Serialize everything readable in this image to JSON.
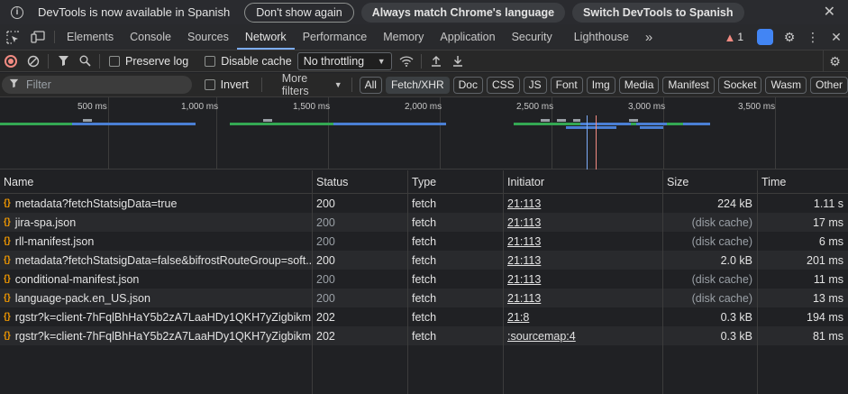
{
  "infobar": {
    "message": "DevTools is now available in Spanish",
    "dont_show": "Don't show again",
    "always_match": "Always match Chrome's language",
    "switch": "Switch DevTools to Spanish",
    "close": "✕"
  },
  "tabs": [
    "Elements",
    "Console",
    "Sources",
    "Network",
    "Performance",
    "Memory",
    "Application",
    "Security",
    "Lighthouse"
  ],
  "active_tab": "Network",
  "more_tabs": "»",
  "issues_count": "1",
  "toolbar": {
    "preserve_log": "Preserve log",
    "disable_cache": "Disable cache",
    "throttling": "No throttling"
  },
  "filter": {
    "placeholder": "Filter",
    "invert": "Invert",
    "more_filters": "More filters",
    "chips": [
      "All",
      "Fetch/XHR",
      "Doc",
      "CSS",
      "JS",
      "Font",
      "Img",
      "Media",
      "Manifest",
      "Socket",
      "Wasm",
      "Other"
    ],
    "active_chip": "Fetch/XHR"
  },
  "overview": {
    "ticks": [
      "500 ms",
      "1,000 ms",
      "1,500 ms",
      "2,000 ms",
      "2,500 ms",
      "3,000 ms",
      "3,500 ms"
    ]
  },
  "table": {
    "headers": {
      "name": "Name",
      "status": "Status",
      "type": "Type",
      "initiator": "Initiator",
      "size": "Size",
      "time": "Time"
    },
    "rows": [
      {
        "name": "metadata?fetchStatsigData=true",
        "status": "200",
        "type": "fetch",
        "initiator": "21:113",
        "size": "224 kB",
        "time": "1.11 s"
      },
      {
        "name": "jira-spa.json",
        "status": "200",
        "type": "fetch",
        "initiator": "21:113",
        "size": "(disk cache)",
        "time": "17 ms"
      },
      {
        "name": "rll-manifest.json",
        "status": "200",
        "type": "fetch",
        "initiator": "21:113",
        "size": "(disk cache)",
        "time": "6 ms"
      },
      {
        "name": "metadata?fetchStatsigData=false&bifrostRouteGroup=soft...",
        "status": "200",
        "type": "fetch",
        "initiator": "21:113",
        "size": "2.0 kB",
        "time": "201 ms"
      },
      {
        "name": "conditional-manifest.json",
        "status": "200",
        "type": "fetch",
        "initiator": "21:113",
        "size": "(disk cache)",
        "time": "11 ms"
      },
      {
        "name": "language-pack.en_US.json",
        "status": "200",
        "type": "fetch",
        "initiator": "21:113",
        "size": "(disk cache)",
        "time": "13 ms"
      },
      {
        "name": "rgstr?k=client-7hFqlBhHaY5b2zA7LaaHDy1QKH7yZigbikm...",
        "status": "202",
        "type": "fetch",
        "initiator": "21:8",
        "size": "0.3 kB",
        "time": "194 ms"
      },
      {
        "name": "rgstr?k=client-7hFqlBhHaY5b2zA7LaaHDy1QKH7yZigbikm...",
        "status": "202",
        "type": "fetch",
        "initiator": ":sourcemap:4",
        "size": "0.3 kB",
        "time": "81 ms"
      }
    ]
  }
}
